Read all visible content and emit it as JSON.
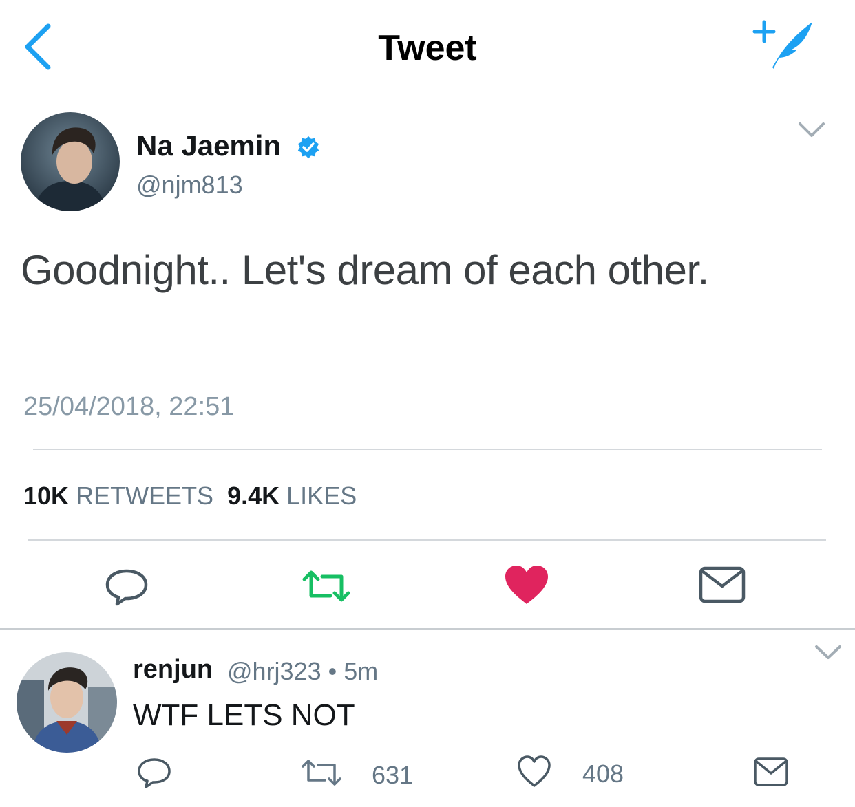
{
  "header": {
    "title": "Tweet",
    "back_icon": "chevron-left-icon",
    "compose_icon": "compose-tweet-icon"
  },
  "tweet": {
    "author": {
      "name": "Na Jaemin",
      "handle": "@njm813",
      "verified": true
    },
    "text": "Goodnight.. Let's dream of each other.",
    "timestamp": "25/04/2018, 22:51",
    "stats": {
      "retweets_count": "10K",
      "retweets_label": "RETWEETS",
      "likes_count": "9.4K",
      "likes_label": "LIKES"
    },
    "actions": [
      "reply-icon",
      "retweet-icon",
      "like-icon",
      "direct-message-icon"
    ],
    "retweeted": true,
    "liked": true
  },
  "reply": {
    "author": {
      "name": "renjun",
      "handle": "@hrj323",
      "time": "• 5m"
    },
    "text": "WTF LETS NOT",
    "retweet_count": "631",
    "like_count": "408"
  },
  "colors": {
    "accent": "#1da1f2",
    "retweet_green": "#17bf63",
    "like_red": "#e0245e",
    "secondary_text": "#657786",
    "icon_gray": "#4a5964"
  }
}
